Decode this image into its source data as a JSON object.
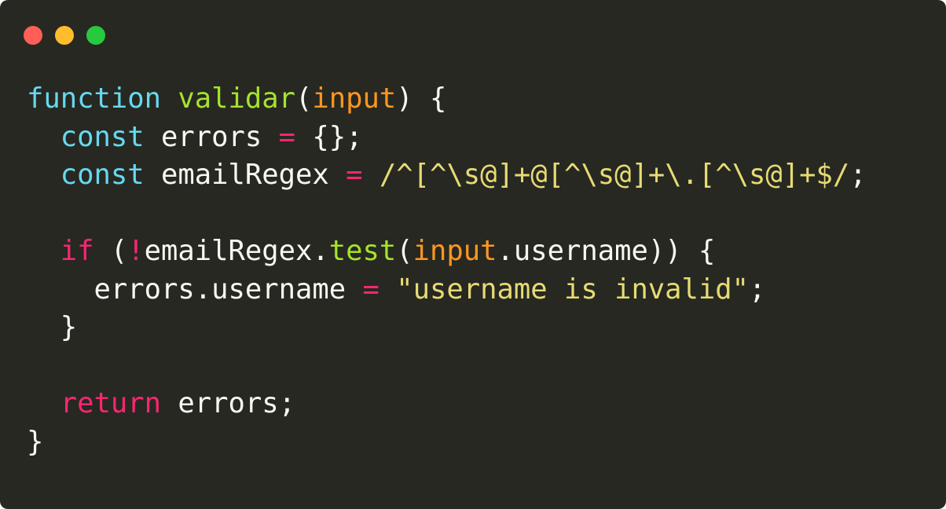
{
  "window": {
    "controls": [
      {
        "name": "close-dot",
        "color": "#ff5f56"
      },
      {
        "name": "minimize-dot",
        "color": "#ffbd2e"
      },
      {
        "name": "maximize-dot",
        "color": "#27c93f"
      }
    ],
    "background": "#272822"
  },
  "palette": {
    "plain": "#f8f8f2",
    "keyword": "#66d9ef",
    "control": "#f92672",
    "function": "#a6e22e",
    "param": "#fd971f",
    "string": "#e6db74"
  },
  "code": {
    "lines": [
      [
        {
          "t": "function",
          "k": "keyword"
        },
        {
          "t": " ",
          "k": "plain"
        },
        {
          "t": "validar",
          "k": "function"
        },
        {
          "t": "(",
          "k": "plain"
        },
        {
          "t": "input",
          "k": "param"
        },
        {
          "t": ") {",
          "k": "plain"
        }
      ],
      [
        {
          "t": "  ",
          "k": "plain"
        },
        {
          "t": "const",
          "k": "keyword"
        },
        {
          "t": " errors ",
          "k": "plain"
        },
        {
          "t": "=",
          "k": "control"
        },
        {
          "t": " {};",
          "k": "plain"
        }
      ],
      [
        {
          "t": "  ",
          "k": "plain"
        },
        {
          "t": "const",
          "k": "keyword"
        },
        {
          "t": " emailRegex ",
          "k": "plain"
        },
        {
          "t": "=",
          "k": "control"
        },
        {
          "t": " ",
          "k": "plain"
        },
        {
          "t": "/^[^\\s@]+@[^\\s@]+\\.[^\\s@]+$/",
          "k": "string"
        },
        {
          "t": ";",
          "k": "plain"
        }
      ],
      [],
      [
        {
          "t": "  ",
          "k": "plain"
        },
        {
          "t": "if",
          "k": "control"
        },
        {
          "t": " (",
          "k": "plain"
        },
        {
          "t": "!",
          "k": "control"
        },
        {
          "t": "emailRegex.",
          "k": "plain"
        },
        {
          "t": "test",
          "k": "function"
        },
        {
          "t": "(",
          "k": "plain"
        },
        {
          "t": "input",
          "k": "param"
        },
        {
          "t": ".username)) {",
          "k": "plain"
        }
      ],
      [
        {
          "t": "    errors.username ",
          "k": "plain"
        },
        {
          "t": "=",
          "k": "control"
        },
        {
          "t": " ",
          "k": "plain"
        },
        {
          "t": "\"username is invalid\"",
          "k": "string"
        },
        {
          "t": ";",
          "k": "plain"
        }
      ],
      [
        {
          "t": "  }",
          "k": "plain"
        }
      ],
      [],
      [
        {
          "t": "  ",
          "k": "plain"
        },
        {
          "t": "return",
          "k": "control"
        },
        {
          "t": " errors;",
          "k": "plain"
        }
      ],
      [
        {
          "t": "}",
          "k": "plain"
        }
      ]
    ]
  }
}
